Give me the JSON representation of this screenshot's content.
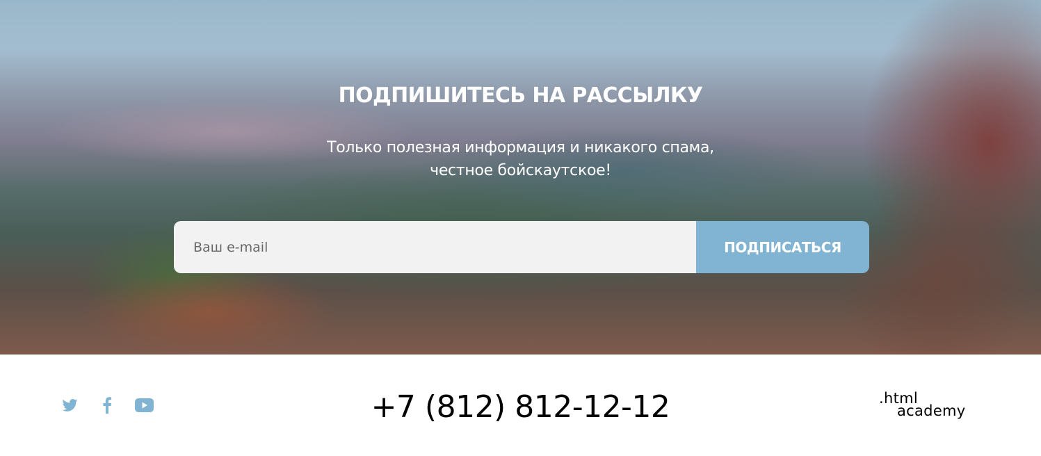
{
  "subscribe": {
    "title": "ПОДПИШИТЕСЬ НА РАССЫЛКУ",
    "text_line1": "Только полезная информация и никакого спама,",
    "text_line2": "честное бойскаутское!",
    "email_placeholder": "Ваш e-mail",
    "button_label": "ПОДПИСАТЬСЯ",
    "button_color": "#81b3d2"
  },
  "footer": {
    "socials": [
      {
        "name": "twitter",
        "icon": "twitter-icon"
      },
      {
        "name": "facebook",
        "icon": "facebook-icon"
      },
      {
        "name": "youtube",
        "icon": "youtube-icon"
      }
    ],
    "social_icon_color": "#81b3d2",
    "phone": "+7 (812) 812-12-12",
    "logo_line1": ".html",
    "logo_line2": "academy"
  }
}
